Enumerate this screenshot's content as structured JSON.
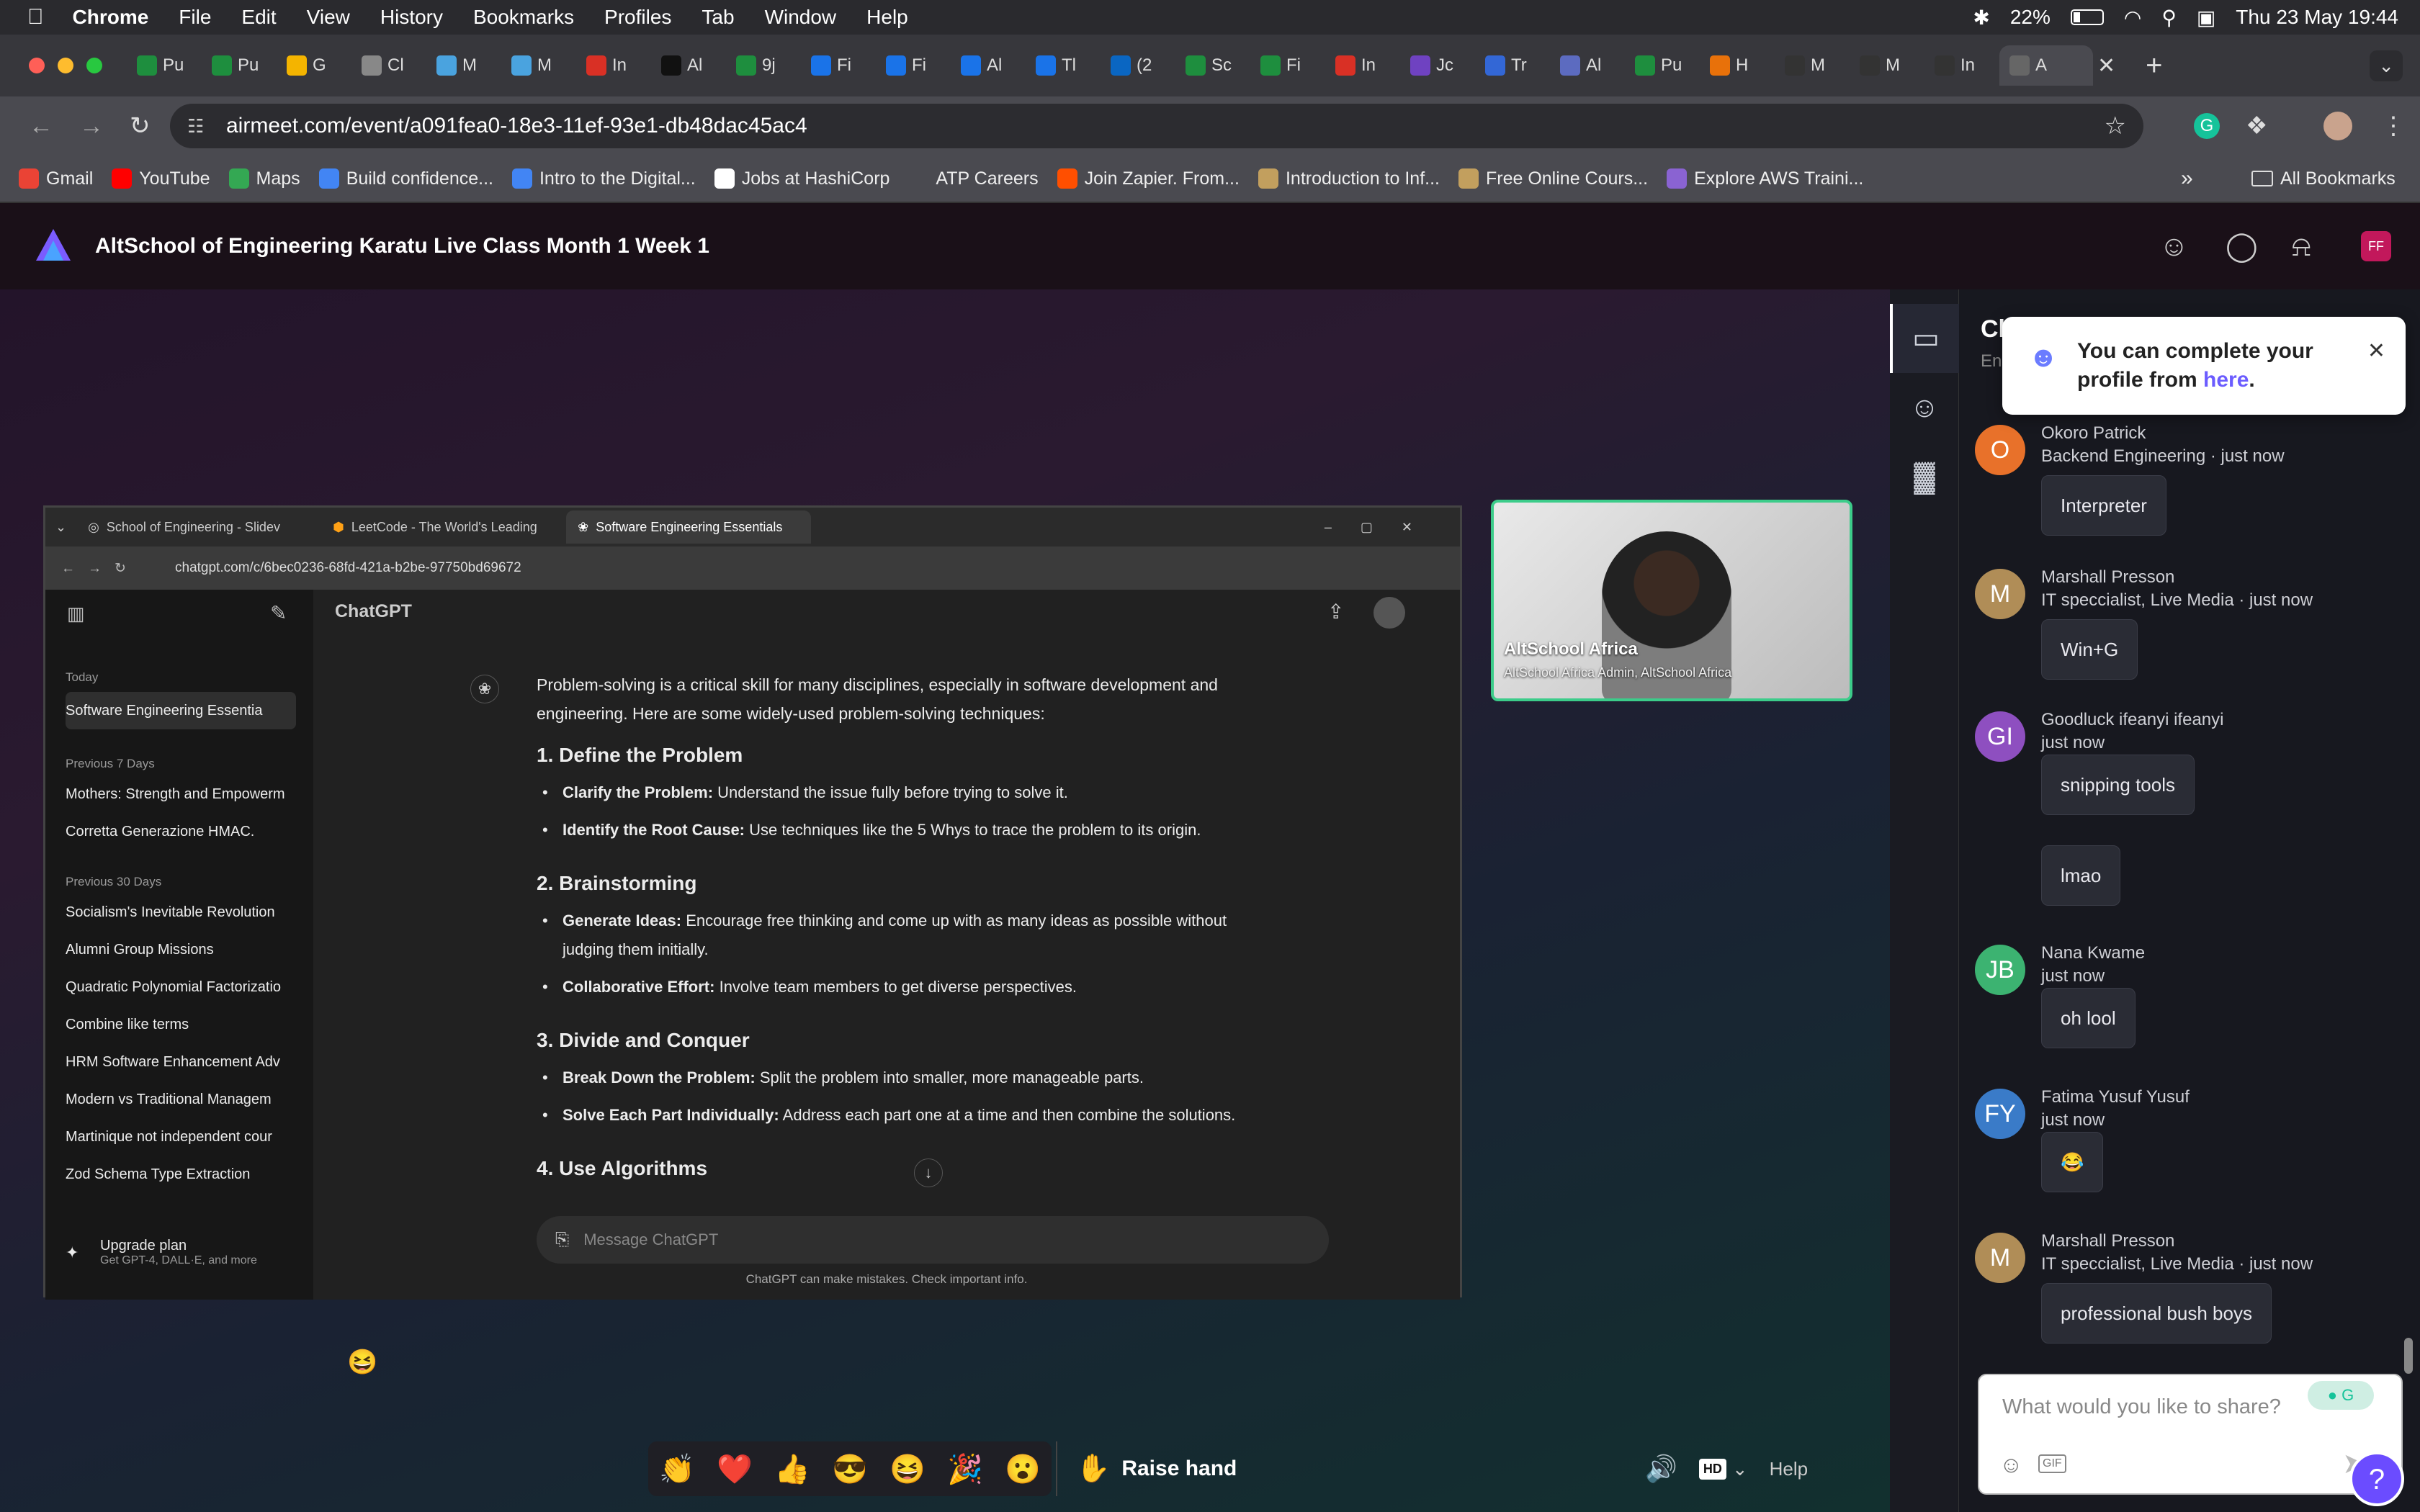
{
  "menubar": {
    "app": "Chrome",
    "items": [
      "File",
      "Edit",
      "View",
      "History",
      "Bookmarks",
      "Profiles",
      "Tab",
      "Window",
      "Help"
    ],
    "battery": "22%",
    "clock": "Thu 23 May  19:44"
  },
  "tabs": [
    {
      "label": "Pu",
      "color": "#1e8e3e"
    },
    {
      "label": "Pu",
      "color": "#1e8e3e"
    },
    {
      "label": "G",
      "color": "#f4b400"
    },
    {
      "label": "Cl",
      "color": "#888"
    },
    {
      "label": "M",
      "color": "#4aa3df"
    },
    {
      "label": "M",
      "color": "#4aa3df"
    },
    {
      "label": "In",
      "color": "#d93025"
    },
    {
      "label": "Al",
      "color": "#111"
    },
    {
      "label": "9j",
      "color": "#1e8e3e"
    },
    {
      "label": "Fi",
      "color": "#1a73e8"
    },
    {
      "label": "Fi",
      "color": "#1a73e8"
    },
    {
      "label": "Al",
      "color": "#1a73e8"
    },
    {
      "label": "Tl",
      "color": "#1a73e8"
    },
    {
      "label": "(2",
      "color": "#0a66c2"
    },
    {
      "label": "Sc",
      "color": "#1e8e3e"
    },
    {
      "label": "Fi",
      "color": "#1e8e3e"
    },
    {
      "label": "In",
      "color": "#d93025"
    },
    {
      "label": "Jc",
      "color": "#6f42c1"
    },
    {
      "label": "Tr",
      "color": "#3367d6"
    },
    {
      "label": "Al",
      "color": "#5c6bc0"
    },
    {
      "label": "Pu",
      "color": "#1e8e3e"
    },
    {
      "label": "H",
      "color": "#e8710a"
    },
    {
      "label": "M",
      "color": "#333"
    },
    {
      "label": "M",
      "color": "#333"
    },
    {
      "label": "In",
      "color": "#333"
    },
    {
      "label": "A",
      "color": "#666"
    }
  ],
  "nav": {
    "url": "airmeet.com/event/a091fea0-18e3-11ef-93e1-db48dac45ac4"
  },
  "bookmarks": [
    {
      "label": "Gmail",
      "color": "#ea4335"
    },
    {
      "label": "YouTube",
      "color": "#ff0000"
    },
    {
      "label": "Maps",
      "color": "#34a853"
    },
    {
      "label": "Build confidence...",
      "color": "#4285f4"
    },
    {
      "label": "Intro to the Digital...",
      "color": "#4285f4"
    },
    {
      "label": "Jobs at HashiCorp",
      "color": "#ffffff"
    },
    {
      "label": "ATP Careers",
      "color": "#4a4a50"
    },
    {
      "label": "Join Zapier. From...",
      "color": "#ff4f00"
    },
    {
      "label": "Introduction to Inf...",
      "color": "#c29f5e"
    },
    {
      "label": "Free Online Cours...",
      "color": "#c29f5e"
    },
    {
      "label": "Explore AWS Traini...",
      "color": "#8a63d2"
    }
  ],
  "bookmarks_all": "All Bookmarks",
  "app": {
    "title": "AltSchool of Engineering Karatu Live Class Month 1 Week 1",
    "avatar": "FF",
    "accent": "#c2185b"
  },
  "shared": {
    "tabs": [
      "School of Engineering - Slidev",
      "LeetCode - The World's Leading",
      "Software Engineering Essentials"
    ],
    "url": "chatgpt.com/c/6bec0236-68fd-421a-b2be-97750bd69672",
    "model": "ChatGPT",
    "sidebar": {
      "today": "Today",
      "today_item": "Software Engineering Essentia",
      "prev7": "Previous 7 Days",
      "prev7_items": [
        "Mothers: Strength and Empowerm",
        "Corretta Generazione HMAC."
      ],
      "prev30": "Previous 30 Days",
      "prev30_items": [
        "Socialism's Inevitable Revolution",
        "Alumni Group Missions",
        "Quadratic Polynomial Factorizatio",
        "Combine like terms",
        "HRM Software Enhancement Adv",
        "Modern vs Traditional Managem",
        "Martinique not independent cour",
        "Zod Schema Type Extraction"
      ],
      "upgrade": "Upgrade plan",
      "upgrade_sub": "Get GPT-4, DALL·E, and more"
    },
    "intro": "Problem-solving is a critical skill for many disciplines, especially in software development and engineering. Here are some widely-used problem-solving techniques:",
    "h1": "1. Define the Problem",
    "h1_b1_t": "Clarify the Problem:",
    "h1_b1": " Understand the issue fully before trying to solve it.",
    "h1_b2_t": "Identify the Root Cause:",
    "h1_b2": " Use techniques like the 5 Whys to trace the problem to its origin.",
    "h2": "2. Brainstorming",
    "h2_b1_t": "Generate Ideas:",
    "h2_b1": " Encourage free thinking and come up with as many ideas as possible without judging them initially.",
    "h2_b2_t": "Collaborative Effort:",
    "h2_b2": " Involve team members to get diverse perspectives.",
    "h3": "3. Divide and Conquer",
    "h3_b1_t": "Break Down the Problem:",
    "h3_b1": " Split the problem into smaller, more manageable parts.",
    "h3_b2_t": "Solve Each Part Individually:",
    "h3_b2": " Address each part one at a time and then combine the solutions.",
    "h4": "4. Use Algorithms",
    "placeholder": "Message ChatGPT",
    "disclaimer": "ChatGPT can make mistakes. Check important info."
  },
  "video": {
    "name": "AltSchool Africa",
    "sub": "AltSchool Africa Admin, AltSchool Africa"
  },
  "reactions": [
    "👏",
    "❤️",
    "👍",
    "😎",
    "😆",
    "🎉",
    "😮"
  ],
  "raise_hand": "Raise hand",
  "controls": {
    "hd": "HD",
    "help": "Help"
  },
  "chat": {
    "header": "Cl",
    "header_sub": "En",
    "toast": {
      "text": "You can complete your profile from ",
      "link": "here",
      "end": "."
    },
    "messages": [
      {
        "initials": "O",
        "color": "#e8712a",
        "name": "Okoro Patrick",
        "role": "Backend Engineering  · just now",
        "text": "Interpreter"
      },
      {
        "initials": "M",
        "color": "#b08d57",
        "name": "Marshall Presson",
        "role": "IT speccialist, Live Media  · just now",
        "text": "Win+G"
      },
      {
        "initials": "GI",
        "color": "#8e4fc0",
        "name": "Goodluck ifeanyi ifeanyi",
        "role": "just now",
        "text": "snipping tools",
        "text2": "lmao"
      },
      {
        "initials": "JB",
        "color": "#3cb371",
        "name": "Nana Kwame",
        "role": "just now",
        "text": "oh lool"
      },
      {
        "initials": "FY",
        "color": "#3a7bc8",
        "name": "Fatima Yusuf Yusuf",
        "role": "just now",
        "text": "😂"
      },
      {
        "initials": "M",
        "color": "#b08d57",
        "name": "Marshall Presson",
        "role": "IT speccialist, Live Media  · just now",
        "text": "professional bush boys"
      }
    ],
    "input_placeholder": "What would you like to share?",
    "gif": "GIF"
  },
  "floating_emoji": "😆"
}
